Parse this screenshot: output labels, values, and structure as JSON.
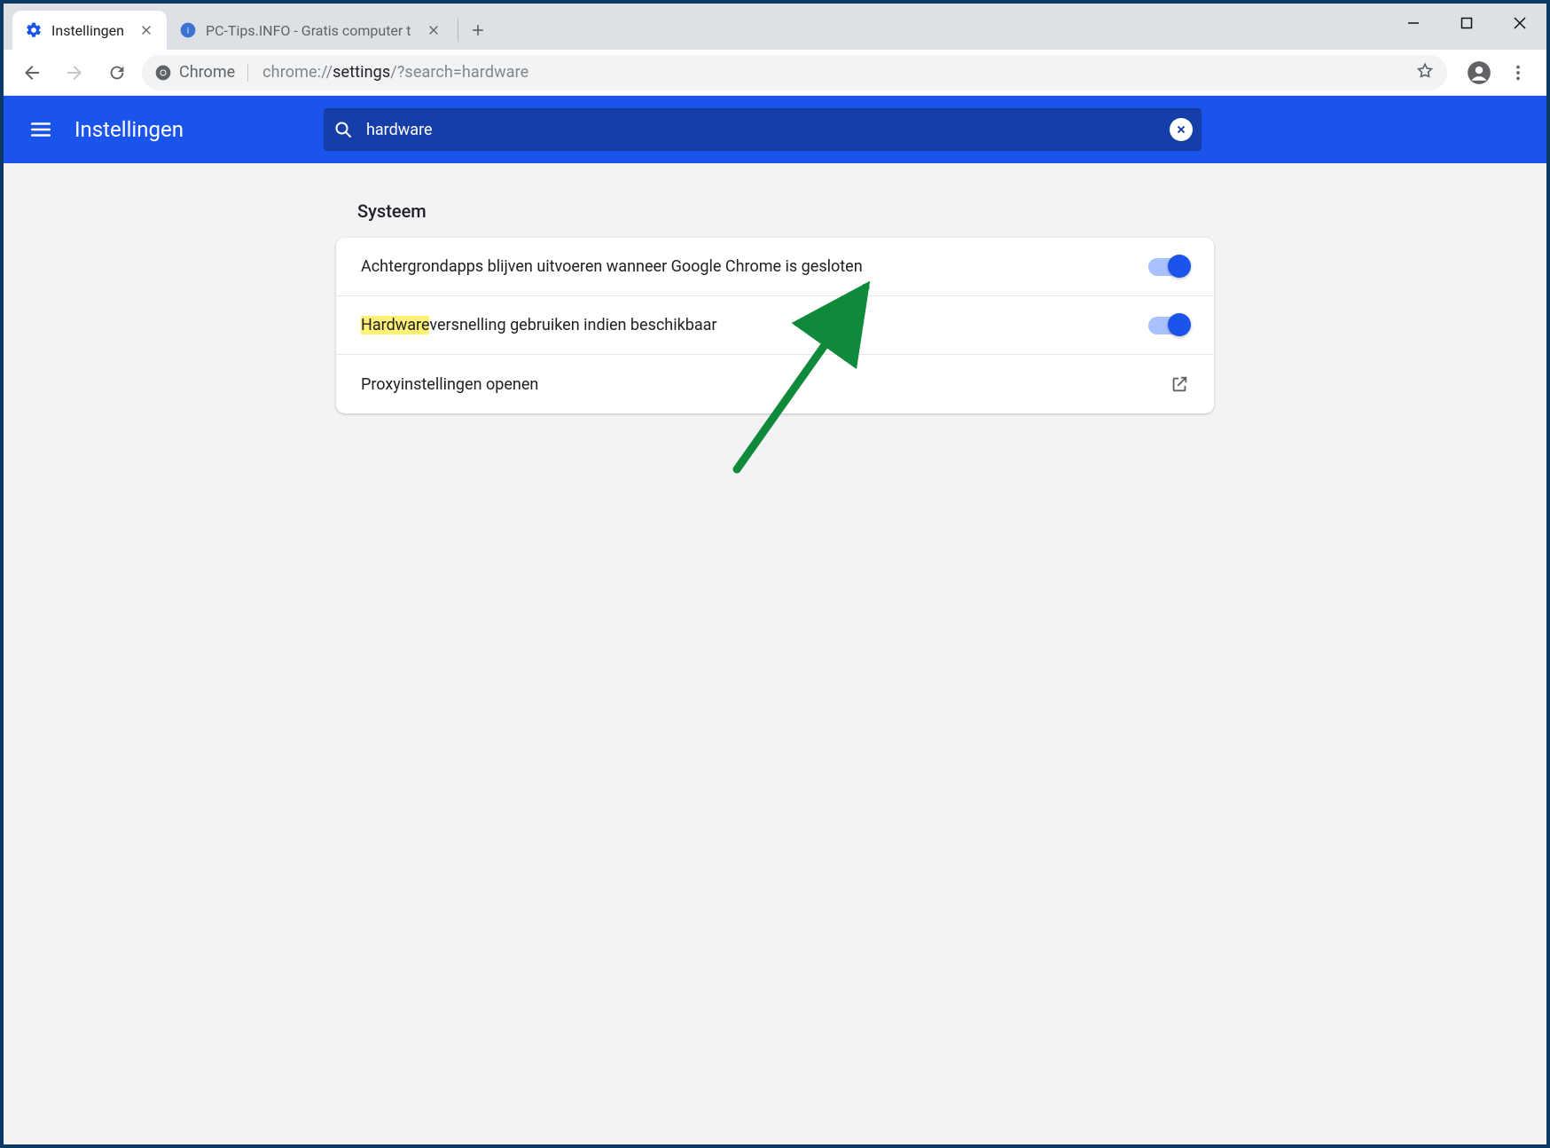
{
  "tabs": [
    {
      "title": "Instellingen",
      "active": true
    },
    {
      "title": "PC-Tips.INFO - Gratis computer t",
      "active": false
    }
  ],
  "omnibox": {
    "chip": "Chrome",
    "url_prefix": "chrome://",
    "url_bold": "settings",
    "url_suffix": "/?search=hardware"
  },
  "settings": {
    "title": "Instellingen",
    "search_value": "hardware",
    "section_title": "Systeem",
    "rows": {
      "background_apps": "Achtergrondapps blijven uitvoeren wanneer Google Chrome is gesloten",
      "hw_accel_highlight": "Hardware",
      "hw_accel_rest": "versnelling gebruiken indien beschikbaar",
      "proxy": "Proxyinstellingen openen"
    }
  }
}
